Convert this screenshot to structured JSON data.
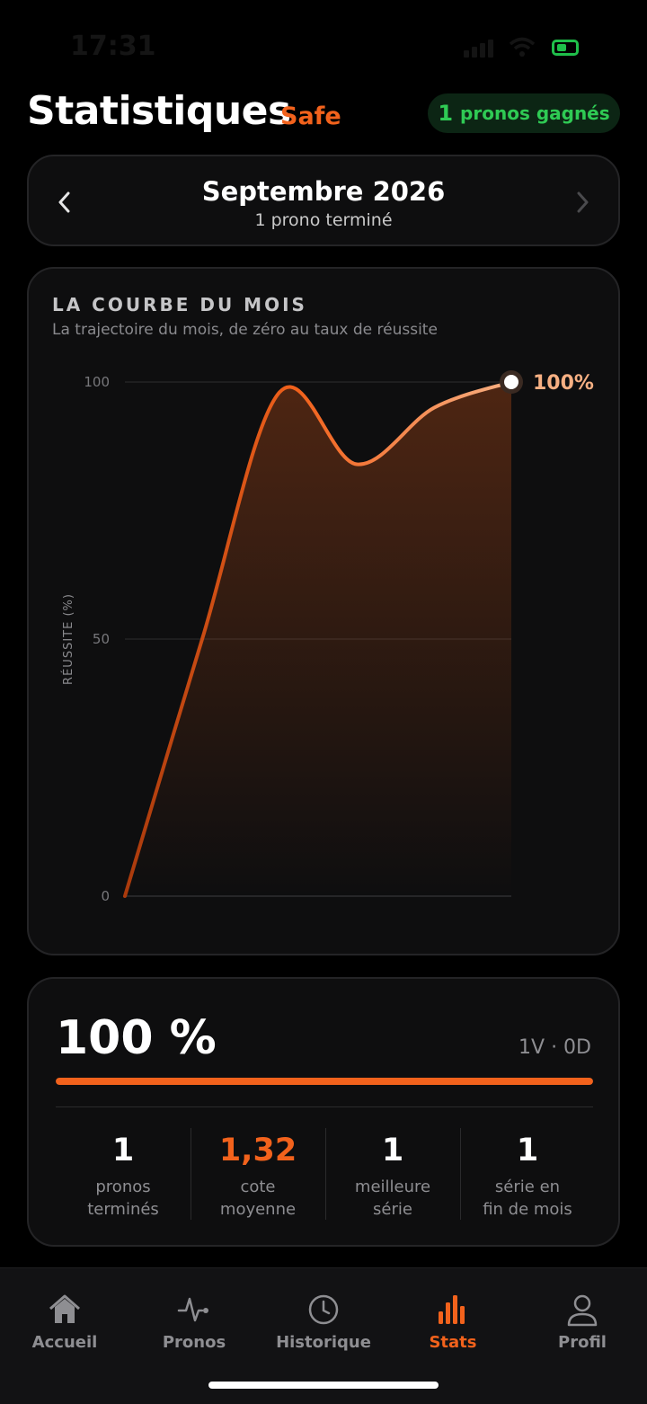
{
  "status_bar": {
    "time": "17:31"
  },
  "header": {
    "title": "Statistiques",
    "tag": "Safe",
    "won_count": "1",
    "won_label": "pronos gagnés"
  },
  "month_selector": {
    "title": "Septembre 2026",
    "subtitle": "1 prono terminé"
  },
  "chart_card": {
    "title": "LA COURBE DU MOIS",
    "subtitle": "La trajectoire du mois, de zéro au taux de réussite",
    "end_label": "100%"
  },
  "chart_data": {
    "type": "line",
    "ylabel": "RÉUSSITE (%)",
    "ylim": [
      0,
      100
    ],
    "yticks": [
      "100",
      "50",
      "0"
    ],
    "y_values": [
      0,
      50,
      98,
      84,
      95,
      100
    ],
    "grid": true,
    "colors": {
      "line_start": "#a93a0c",
      "line_end": "#f7b083",
      "fill": "#f2621c"
    }
  },
  "rate_card": {
    "rate": "100 %",
    "rate_value": 100,
    "record": "1V · 0D",
    "kpis": [
      {
        "value": "1",
        "label_line1": "pronos",
        "label_line2": "terminés",
        "accent": false
      },
      {
        "value": "1,32",
        "label_line1": "cote",
        "label_line2": "moyenne",
        "accent": true
      },
      {
        "value": "1",
        "label_line1": "meilleure",
        "label_line2": "série",
        "accent": false
      },
      {
        "value": "1",
        "label_line1": "série en",
        "label_line2": "fin de mois",
        "accent": false
      }
    ]
  },
  "bottom_nav": [
    {
      "label": "Accueil",
      "icon": "home-icon",
      "active": false
    },
    {
      "label": "Pronos",
      "icon": "pulse-icon",
      "active": false
    },
    {
      "label": "Historique",
      "icon": "clock-icon",
      "active": false
    },
    {
      "label": "Stats",
      "icon": "bar-chart-icon",
      "active": true
    },
    {
      "label": "Profil",
      "icon": "user-icon",
      "active": false
    }
  ],
  "colors": {
    "accent": "#f2621c",
    "success": "#2fca54",
    "background": "#000000",
    "card": "#0e0e0f"
  }
}
